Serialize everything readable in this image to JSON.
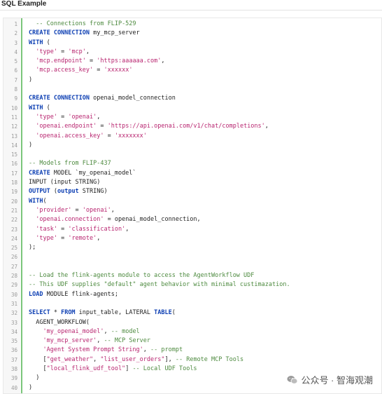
{
  "panel": {
    "title": "SQL Example"
  },
  "colors": {
    "keyword": "#0d3fb3",
    "string": "#b8246f",
    "comment": "#4d8a3f",
    "gutter_bar": "#7bc67b"
  },
  "code": {
    "lines": [
      {
        "n": "1",
        "tokens": [
          {
            "t": "  "
          },
          {
            "t": "-- Connections from FLIP-529",
            "c": "cm"
          }
        ]
      },
      {
        "n": "2",
        "tokens": [
          {
            "t": "CREATE CONNECTION",
            "c": "kw"
          },
          {
            "t": " my_mcp_server"
          }
        ]
      },
      {
        "n": "3",
        "tokens": [
          {
            "t": "WITH",
            "c": "kw"
          },
          {
            "t": " ("
          }
        ]
      },
      {
        "n": "4",
        "tokens": [
          {
            "t": "  "
          },
          {
            "t": "'type'",
            "c": "str"
          },
          {
            "t": " = "
          },
          {
            "t": "'mcp'",
            "c": "str"
          },
          {
            "t": ","
          }
        ]
      },
      {
        "n": "5",
        "tokens": [
          {
            "t": "  "
          },
          {
            "t": "'mcp.endpoint'",
            "c": "str"
          },
          {
            "t": " = "
          },
          {
            "t": "'https:aaaaaa.com'",
            "c": "str"
          },
          {
            "t": ","
          }
        ]
      },
      {
        "n": "6",
        "tokens": [
          {
            "t": "  "
          },
          {
            "t": "'mcp.access_key'",
            "c": "str"
          },
          {
            "t": " = "
          },
          {
            "t": "'xxxxxx'",
            "c": "str"
          }
        ]
      },
      {
        "n": "7",
        "tokens": [
          {
            "t": ")"
          }
        ]
      },
      {
        "n": "8",
        "tokens": []
      },
      {
        "n": "9",
        "tokens": [
          {
            "t": "CREATE CONNECTION",
            "c": "kw"
          },
          {
            "t": " openai_model_connection"
          }
        ]
      },
      {
        "n": "10",
        "tokens": [
          {
            "t": "WITH",
            "c": "kw"
          },
          {
            "t": " ("
          }
        ]
      },
      {
        "n": "11",
        "tokens": [
          {
            "t": "  "
          },
          {
            "t": "'type'",
            "c": "str"
          },
          {
            "t": " = "
          },
          {
            "t": "'openai'",
            "c": "str"
          },
          {
            "t": ","
          }
        ]
      },
      {
        "n": "12",
        "tokens": [
          {
            "t": "  "
          },
          {
            "t": "'openai.endpoint'",
            "c": "str"
          },
          {
            "t": " = "
          },
          {
            "t": "'https://api.openai.com/v1/chat/completions'",
            "c": "str"
          },
          {
            "t": ","
          }
        ]
      },
      {
        "n": "13",
        "tokens": [
          {
            "t": "  "
          },
          {
            "t": "'openai.access_key'",
            "c": "str"
          },
          {
            "t": " = "
          },
          {
            "t": "'xxxxxxx'",
            "c": "str"
          }
        ]
      },
      {
        "n": "14",
        "tokens": [
          {
            "t": ")"
          }
        ]
      },
      {
        "n": "15",
        "tokens": []
      },
      {
        "n": "16",
        "tokens": [
          {
            "t": "-- Models from FLIP-437",
            "c": "cm"
          }
        ]
      },
      {
        "n": "17",
        "tokens": [
          {
            "t": "CREATE",
            "c": "kw"
          },
          {
            "t": " MODEL `my_openai_model`"
          }
        ]
      },
      {
        "n": "18",
        "tokens": [
          {
            "t": "INPUT (input STRING)"
          }
        ]
      },
      {
        "n": "19",
        "tokens": [
          {
            "t": "OUTPUT",
            "c": "kw"
          },
          {
            "t": " ("
          },
          {
            "t": "output",
            "c": "kw"
          },
          {
            "t": " STRING)"
          }
        ]
      },
      {
        "n": "20",
        "tokens": [
          {
            "t": "WITH",
            "c": "kw"
          },
          {
            "t": "("
          }
        ]
      },
      {
        "n": "21",
        "tokens": [
          {
            "t": "  "
          },
          {
            "t": "'provider'",
            "c": "str"
          },
          {
            "t": " = "
          },
          {
            "t": "'openai'",
            "c": "str"
          },
          {
            "t": ","
          }
        ]
      },
      {
        "n": "22",
        "tokens": [
          {
            "t": "  "
          },
          {
            "t": "'openai.connection'",
            "c": "str"
          },
          {
            "t": " = openai_model_connection,"
          }
        ]
      },
      {
        "n": "23",
        "tokens": [
          {
            "t": "  "
          },
          {
            "t": "'task'",
            "c": "str"
          },
          {
            "t": " = "
          },
          {
            "t": "'classification'",
            "c": "str"
          },
          {
            "t": ","
          }
        ]
      },
      {
        "n": "24",
        "tokens": [
          {
            "t": "  "
          },
          {
            "t": "'type'",
            "c": "str"
          },
          {
            "t": " = "
          },
          {
            "t": "'remote'",
            "c": "str"
          },
          {
            "t": ","
          }
        ]
      },
      {
        "n": "25",
        "tokens": [
          {
            "t": ");"
          }
        ]
      },
      {
        "n": "26",
        "tokens": []
      },
      {
        "n": "27",
        "tokens": []
      },
      {
        "n": "28",
        "tokens": [
          {
            "t": "-- Load the flink-agents module to access the AgentWorkflow UDF",
            "c": "cm"
          }
        ]
      },
      {
        "n": "29",
        "tokens": [
          {
            "t": "-- This UDF supplies \"default\" agent behavior with minimal custimazation.",
            "c": "cm"
          }
        ]
      },
      {
        "n": "30",
        "tokens": [
          {
            "t": "LOAD",
            "c": "kw"
          },
          {
            "t": " MODULE flink-agents;"
          }
        ]
      },
      {
        "n": "31",
        "tokens": []
      },
      {
        "n": "32",
        "tokens": [
          {
            "t": "SELECT",
            "c": "kw"
          },
          {
            "t": " * "
          },
          {
            "t": "FROM",
            "c": "kw"
          },
          {
            "t": " input_table, LATERAL "
          },
          {
            "t": "TABLE",
            "c": "kw"
          },
          {
            "t": "("
          }
        ]
      },
      {
        "n": "33",
        "tokens": [
          {
            "t": "  AGENT_WORKFLOW("
          }
        ]
      },
      {
        "n": "34",
        "tokens": [
          {
            "t": "    "
          },
          {
            "t": "'my_openai_model'",
            "c": "str"
          },
          {
            "t": ", "
          },
          {
            "t": "-- model",
            "c": "cm"
          }
        ]
      },
      {
        "n": "35",
        "tokens": [
          {
            "t": "    "
          },
          {
            "t": "'my_mcp_server'",
            "c": "str"
          },
          {
            "t": ", "
          },
          {
            "t": "-- MCP Server",
            "c": "cm"
          }
        ]
      },
      {
        "n": "36",
        "tokens": [
          {
            "t": "    "
          },
          {
            "t": "'Agent System Prompt String'",
            "c": "str"
          },
          {
            "t": ", "
          },
          {
            "t": "-- prompt",
            "c": "cm"
          }
        ]
      },
      {
        "n": "37",
        "tokens": [
          {
            "t": "    ["
          },
          {
            "t": "\"get_weather\"",
            "c": "str"
          },
          {
            "t": ", "
          },
          {
            "t": "\"list_user_orders\"",
            "c": "str"
          },
          {
            "t": "], "
          },
          {
            "t": "-- Remote MCP Tools",
            "c": "cm"
          }
        ]
      },
      {
        "n": "38",
        "tokens": [
          {
            "t": "    ["
          },
          {
            "t": "\"local_flink_udf_tool\"",
            "c": "str"
          },
          {
            "t": "] "
          },
          {
            "t": "-- Local UDF Tools",
            "c": "cm"
          }
        ]
      },
      {
        "n": "39",
        "tokens": [
          {
            "t": "  )"
          }
        ]
      },
      {
        "n": "40",
        "tokens": [
          {
            "t": ")"
          }
        ]
      }
    ]
  },
  "watermark": {
    "text": "公众号 · 智海观潮",
    "icon": "wechat-icon"
  }
}
